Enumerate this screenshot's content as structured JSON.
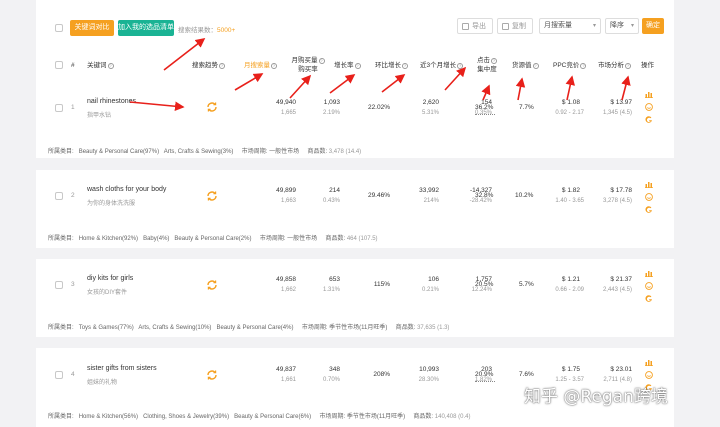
{
  "toolbar": {
    "compare_label": "关键词对比",
    "add_list_label": "加入我的选品清单",
    "result_label": "搜索结果数：",
    "result_count": "5000+",
    "export_label": "导出",
    "copy_label": "复制",
    "sort_field": "月搜索量",
    "sort_order": "降序",
    "confirm_label": "确定"
  },
  "columns": {
    "index": "#",
    "keyword": "关键词",
    "trend": "搜索趋势",
    "monthly_search": "月搜索量",
    "monthly_buy_1": "月购买量",
    "monthly_buy_2": "购买率",
    "growth_rate": "增长率",
    "mom_growth": "环比增长",
    "three_month": "近3个月增长",
    "click_1": "点击",
    "click_2": "集中度",
    "supply_value": "货源值",
    "ppc": "PPC竞价",
    "market": "市场分析",
    "action": "操作"
  },
  "rows": [
    {
      "index": "1",
      "keyword": "nail rhinestones",
      "keyword_cn": "指甲水钻",
      "search": "49,940",
      "search_sub": "1,665",
      "buy": "1,093",
      "buy_sub": "2.19%",
      "growth": "22.02%",
      "mom": "2,620",
      "mom_sub": "5.31%",
      "three": "154",
      "three_sub": "0.35%",
      "click": "36.2%",
      "supply": "7.7%",
      "ppc": "$ 1.08",
      "ppc_sub": "0.92 - 2.17",
      "market": "$ 13.97",
      "market_sub": "1,345 (4.5)",
      "category_label": "所属类目:",
      "categories": [
        "Beauty & Personal Care(97%)",
        "Arts, Crafts & Sewing(3%)"
      ],
      "cycle": "市场周期: 一般性市场",
      "goods": "商品数:",
      "goods_value": "3,478 (14.4)"
    },
    {
      "index": "2",
      "keyword": "wash cloths for your body",
      "keyword_cn": "为你的身体洗洗服",
      "search": "49,899",
      "search_sub": "1,663",
      "buy": "214",
      "buy_sub": "0.43%",
      "growth": "29.46%",
      "mom": "33,992",
      "mom_sub": "214%",
      "three": "-14,327",
      "three_sub": "-28.42%",
      "click": "32.8%",
      "supply": "10.2%",
      "ppc": "$ 1.82",
      "ppc_sub": "1.40 - 3.65",
      "market": "$ 17.78",
      "market_sub": "3,278 (4.5)",
      "category_label": "所属类目:",
      "categories": [
        "Home & Kitchen(92%)",
        "Baby(4%)",
        "Beauty & Personal Care(2%)"
      ],
      "cycle": "市场周期: 一般性市场",
      "goods": "商品数:",
      "goods_value": "464 (107.5)"
    },
    {
      "index": "3",
      "keyword": "diy kits for girls",
      "keyword_cn": "女孩的DIY套件",
      "search": "49,858",
      "search_sub": "1,662",
      "buy": "653",
      "buy_sub": "1.31%",
      "growth": "115%",
      "mom": "106",
      "mom_sub": "0.21%",
      "three": "1,757",
      "three_sub": "12.24%",
      "click": "20.5%",
      "supply": "5.7%",
      "ppc": "$ 1.21",
      "ppc_sub": "0.66 - 2.09",
      "market": "$ 21.37",
      "market_sub": "2,443 (4.5)",
      "category_label": "所属类目:",
      "categories": [
        "Toys & Games(77%)",
        "Arts, Crafts & Sewing(10%)",
        "Beauty & Personal Care(4%)"
      ],
      "cycle": "市场周期: 季节性市场(11月旺季)",
      "goods": "商品数:",
      "goods_value": "37,635 (1.3)"
    },
    {
      "index": "4",
      "keyword": "sister gifts from sisters",
      "keyword_cn": "姐妹的礼物",
      "search": "49,837",
      "search_sub": "1,661",
      "buy": "348",
      "buy_sub": "0.70%",
      "growth": "208%",
      "mom": "10,993",
      "mom_sub": "28.30%",
      "three": "203",
      "three_sub": "1.82%",
      "click": "20.9%",
      "supply": "7.6%",
      "ppc": "$ 1.75",
      "ppc_sub": "1.25 - 3.57",
      "market": "$ 23.01",
      "market_sub": "2,711 (4.8)",
      "category_label": "所属类目:",
      "categories": [
        "Home & Kitchen(56%)",
        "Clothing, Shoes & Jewelry(39%)",
        "Beauty & Personal Care(6%)"
      ],
      "cycle": "市场周期: 季节性市场(11月旺季)",
      "goods": "商品数:",
      "goods_value": "140,408 (0.4)"
    }
  ],
  "watermark": "知乎 @Regan跨境",
  "colors": {
    "accent": "#f5a020",
    "teal": "#1ab394",
    "annotation": "#e8201a"
  },
  "icons": [
    "refresh-icon",
    "bar-chart-icon",
    "smile-icon",
    "google-icon",
    "export-icon",
    "copy-icon"
  ]
}
